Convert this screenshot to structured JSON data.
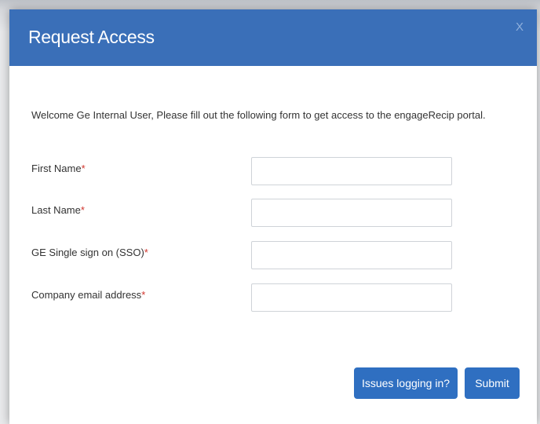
{
  "dialog": {
    "title": "Request Access",
    "close_label": "X",
    "intro": "Welcome Ge Internal User, Please fill out the following form to get access to the engageRecip portal."
  },
  "form": {
    "required_mark": "*",
    "fields": [
      {
        "label": "First Name",
        "value": "",
        "placeholder": ""
      },
      {
        "label": "Last Name",
        "value": "",
        "placeholder": ""
      },
      {
        "label": "GE Single sign on (SSO)",
        "value": "",
        "placeholder": ""
      },
      {
        "label": "Company email address",
        "value": "",
        "placeholder": ""
      }
    ]
  },
  "actions": {
    "issues_label": "Issues logging in?",
    "submit_label": "Submit"
  },
  "colors": {
    "header_bg": "#3a6fb8",
    "button_bg": "#2f6fc1",
    "required_mark": "#d0342c"
  }
}
